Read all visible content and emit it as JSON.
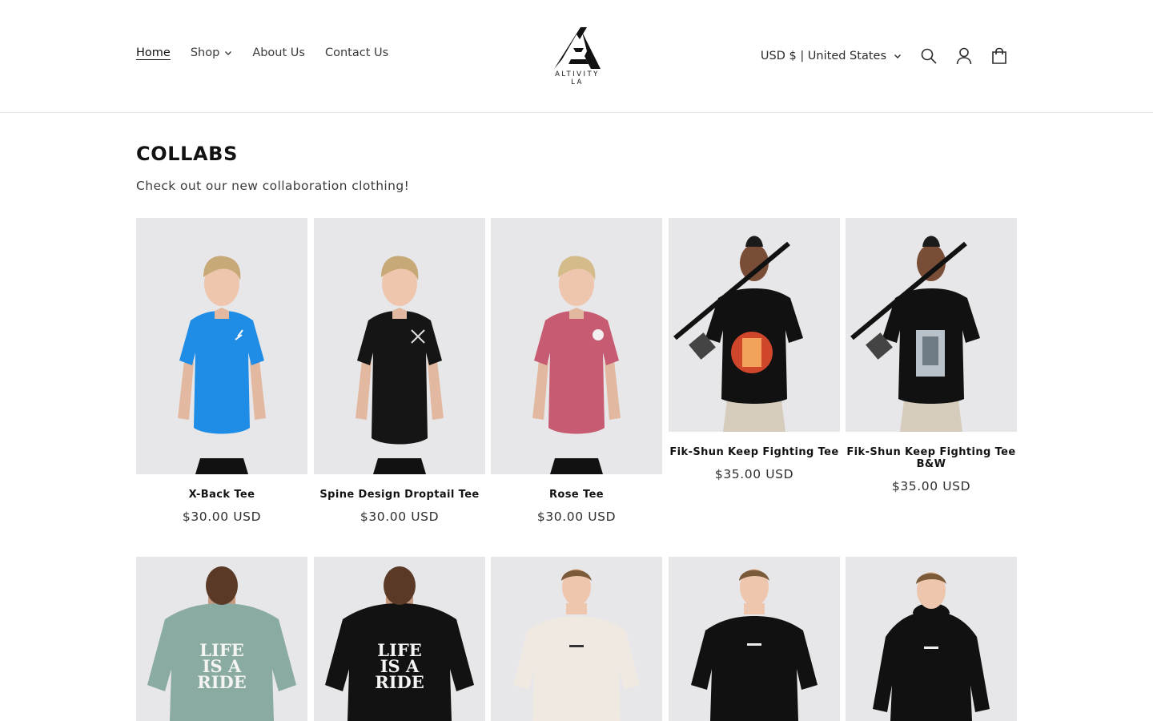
{
  "header": {
    "nav": [
      {
        "label": "Home"
      },
      {
        "label": "Shop"
      },
      {
        "label": "About Us"
      },
      {
        "label": "Contact Us"
      }
    ],
    "logo_text": "ALTIVITY",
    "logo_subtext": "LA",
    "currency": "USD $ | United States",
    "icons": [
      "search-icon",
      "account-icon",
      "cart-icon"
    ]
  },
  "collection": {
    "title": "COLLABS",
    "description": "Check out our new collaboration clothing!"
  },
  "products": [
    {
      "title": "X-Back Tee",
      "price": "$30.00 USD",
      "shirt_color": "#1f8de6"
    },
    {
      "title": "Spine Design Droptail Tee",
      "price": "$30.00 USD",
      "shirt_color": "#151515"
    },
    {
      "title": "Rose Tee",
      "price": "$30.00 USD",
      "shirt_color": "#c65b71"
    },
    {
      "title": "Fik-Shun Keep Fighting Tee",
      "price": "$35.00 USD",
      "shirt_color": "#111111"
    },
    {
      "title": "Fik-Shun Keep Fighting Tee B&W",
      "price": "$35.00 USD",
      "shirt_color": "#111111"
    }
  ],
  "products_row2": [
    {
      "graphic_text": "LIFE IS A RIDE",
      "shirt_color": "#8aaba2"
    },
    {
      "graphic_text": "LIFE IS A RIDE",
      "shirt_color": "#121212"
    },
    {
      "shirt_color": "#efe9e2"
    },
    {
      "shirt_color": "#111111"
    },
    {
      "shirt_color": "#111111"
    }
  ],
  "colors": {
    "text": "#121212",
    "muted": "#3b3b3b",
    "border": "#e6e6e6",
    "image_bg": "#e8e8ea"
  }
}
